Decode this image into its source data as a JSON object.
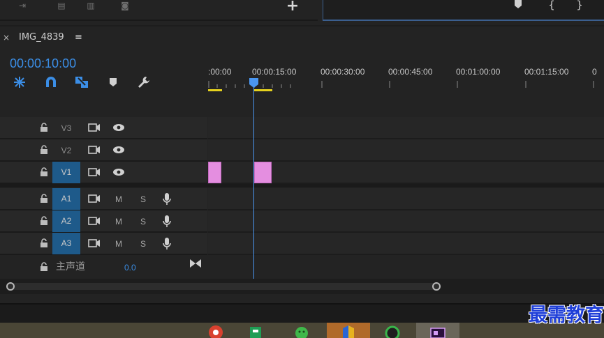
{
  "sequence": {
    "title": "IMG_4839",
    "close": "×",
    "menu": "≡",
    "timecode": "00:00:10:00"
  },
  "ruler": {
    "labels": [
      ":00:00",
      "00:00:15:00",
      "00:00:30:00",
      "00:00:45:00",
      "00:01:00:00",
      "00:01:15:00",
      "0"
    ]
  },
  "top": {
    "add": "+",
    "brace_open": "{",
    "brace_close": "}"
  },
  "video_tracks": [
    {
      "label": "V3"
    },
    {
      "label": "V2"
    },
    {
      "label": "V1"
    }
  ],
  "audio_tracks": [
    {
      "label": "A1",
      "mute": "M",
      "solo": "S"
    },
    {
      "label": "A2",
      "mute": "M",
      "solo": "S"
    },
    {
      "label": "A3",
      "mute": "M",
      "solo": "S"
    }
  ],
  "master": {
    "label": "主声道",
    "value": "0.0"
  },
  "watermark": "最需教育",
  "colors": {
    "accent": "#3b8ee6",
    "clip": "#e48ee0",
    "track_target": "#1e5a8a",
    "work_area": "#e6d21e"
  }
}
